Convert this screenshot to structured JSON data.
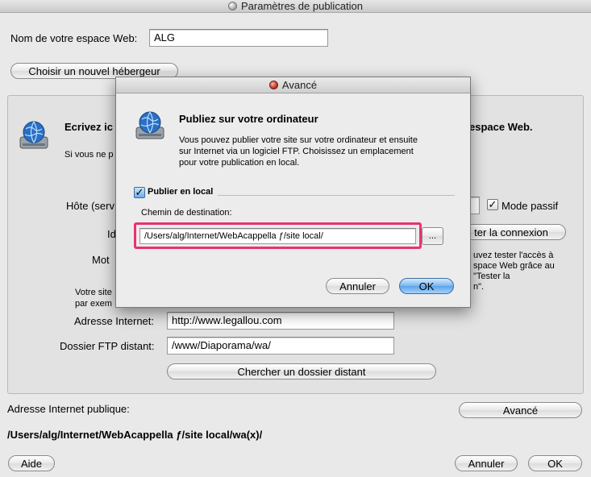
{
  "window": {
    "title": "Paramètres de publication"
  },
  "main": {
    "space_label": "Nom de votre espace Web:",
    "space_value": "ALG",
    "choose_host_button": "Choisir un nouvel hébergeur",
    "group": {
      "heading_left": "Ecrivez ic",
      "heading_right": "espace Web.",
      "subtext_left": "Si vous ne p",
      "host_label": "Hôte (serv",
      "id_label_fragment": "Id",
      "password_label_fragment": "Mot",
      "passive_mode_label": "Mode passif",
      "test_connection_button": "ter la connexion",
      "test_hint_lines": [
        "uvez tester l'accès à",
        "space Web grâce au",
        "\"Tester la",
        "n\"."
      ],
      "site_note_lines": [
        "Votre site",
        "par exem"
      ],
      "internet_address_label": "Adresse Internet:",
      "internet_address_value": "http://www.legallou.com",
      "ftp_folder_label": "Dossier FTP distant:",
      "ftp_folder_value": "/www/Diaporama/wa/",
      "find_remote_button": "Chercher un dossier distant"
    },
    "public_address_label": "Adresse Internet publique:",
    "public_path": "/Users/alg/Internet/WebAcappella ƒ/site local/wa(x)/",
    "advanced_button": "Avancé",
    "help_button": "Aide",
    "cancel_button": "Annuler",
    "ok_button": "OK"
  },
  "modal": {
    "title": "Avancé",
    "heading": "Publiez sur votre ordinateur",
    "description_lines": [
      "Vous pouvez publier votre site sur votre ordinateur et ensuite",
      "sur Internet via un logiciel FTP. Choisissez un emplacement",
      "pour votre publication en local."
    ],
    "local_publish_label": "Publier en local",
    "destination_label": "Chemin de destination:",
    "destination_value": "/Users/alg/Internet/WebAcappella ƒ/site local/",
    "browse_button": "...",
    "cancel_button": "Annuler",
    "ok_button": "OK"
  },
  "icons": {
    "window_close": "close-dot-icon",
    "globe": "globe-disk-icon",
    "check": "checkmark-icon"
  },
  "colors": {
    "highlight": "#e8336c",
    "default_button": "#5ba3ea"
  }
}
